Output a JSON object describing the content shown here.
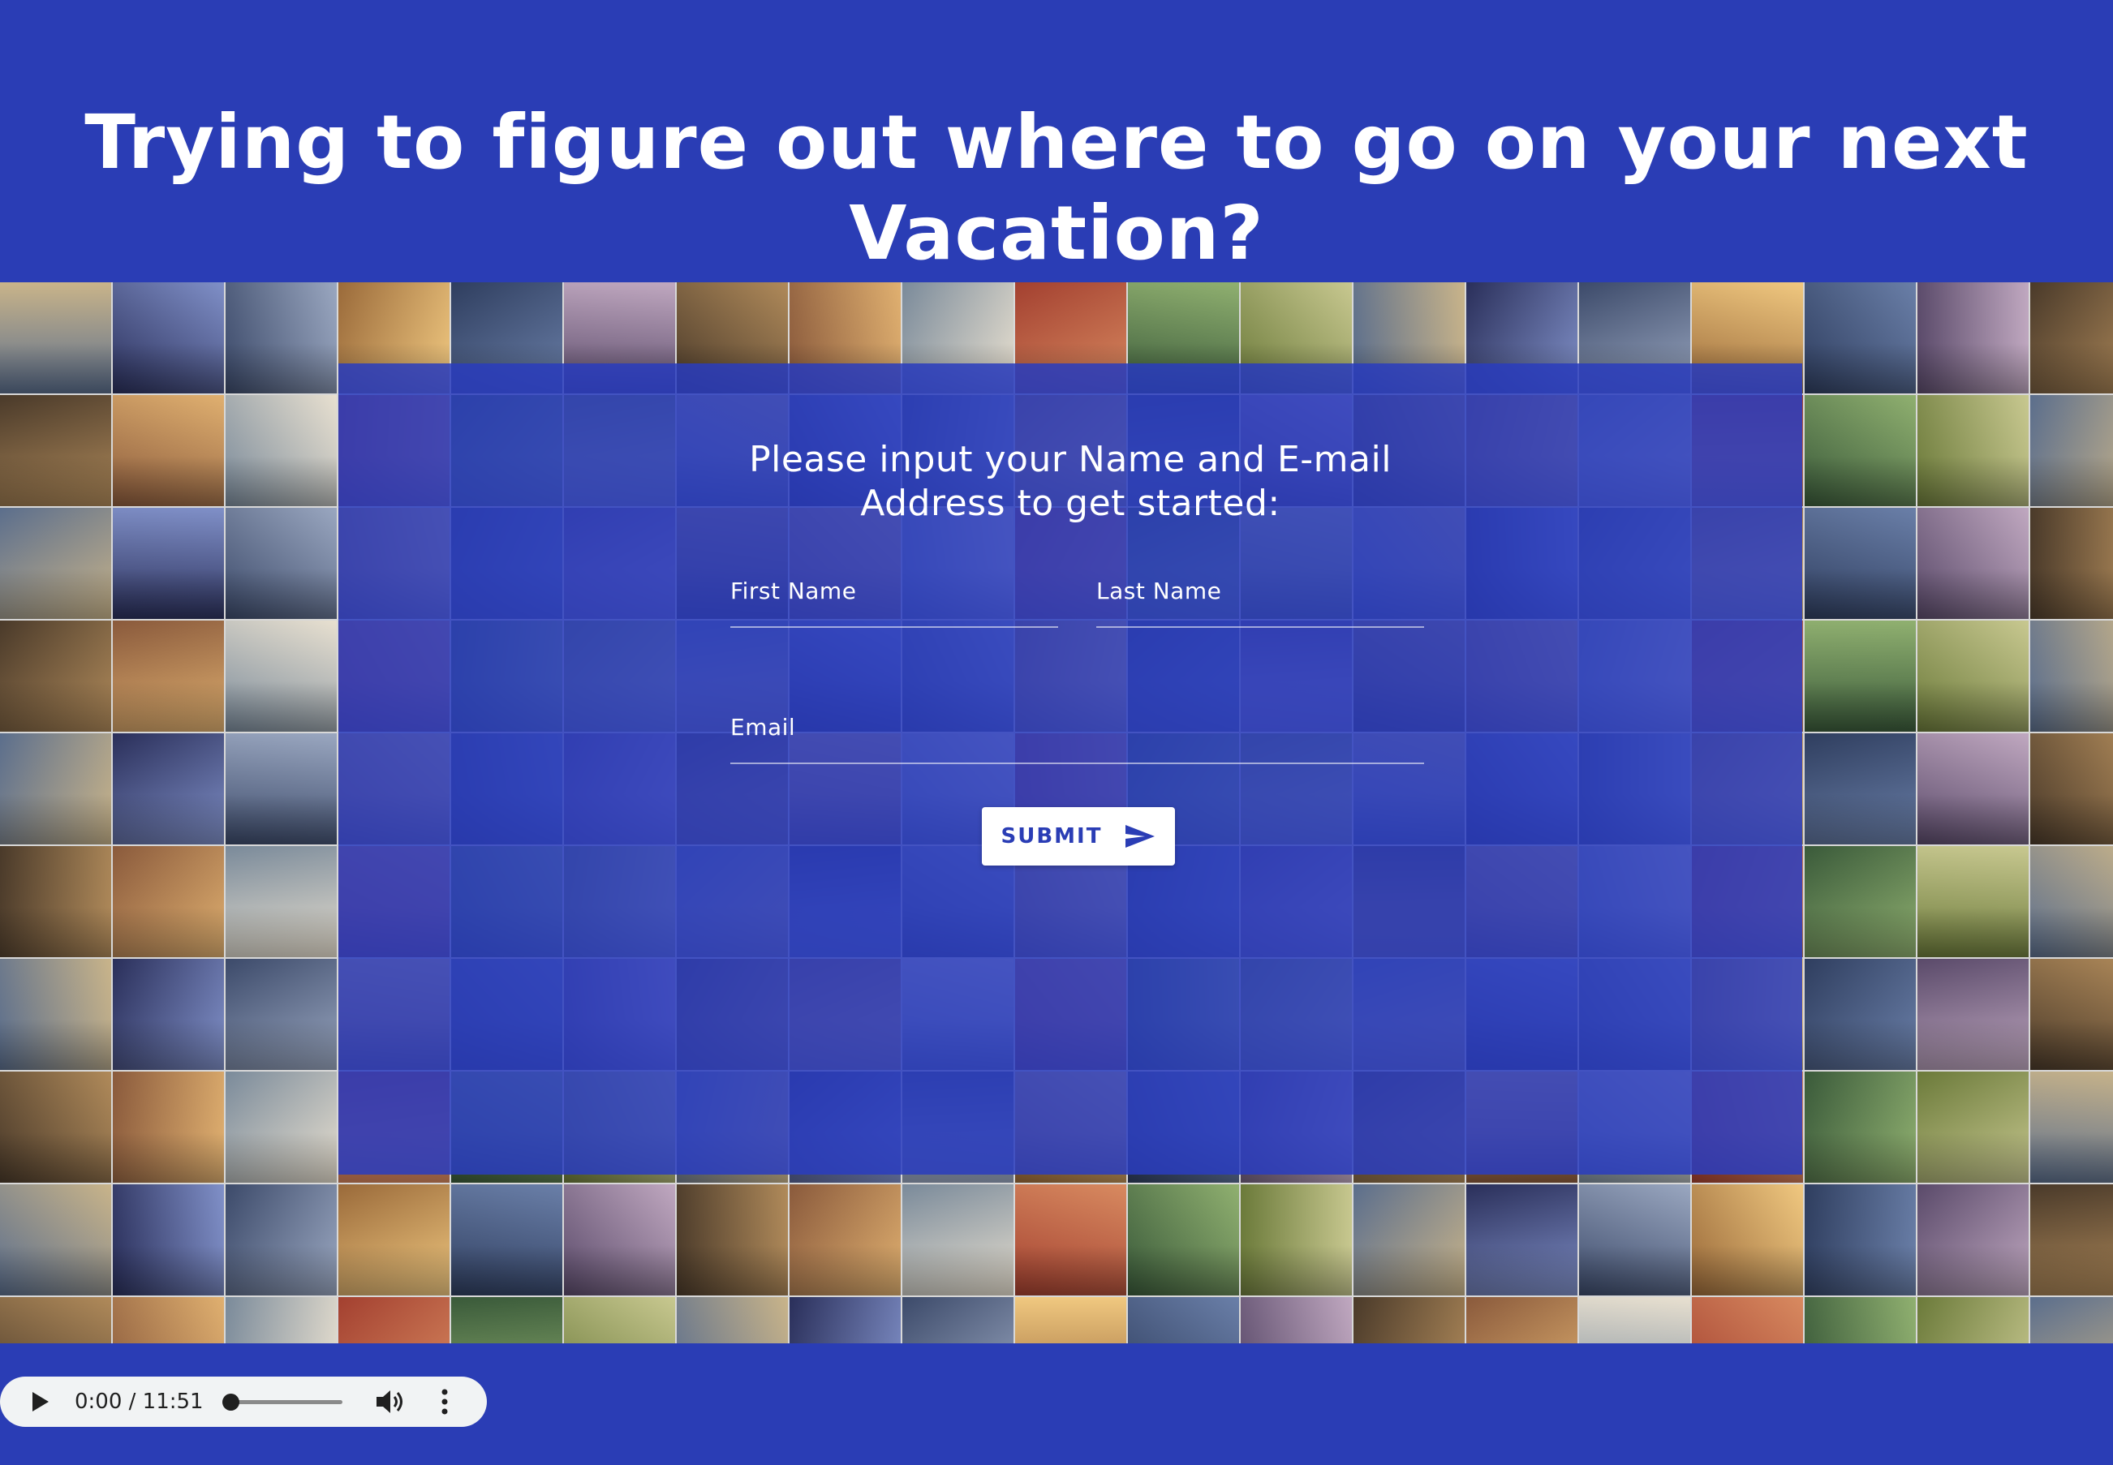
{
  "hero": {
    "title_line1": "Trying to figure out where to go on your next",
    "title_line2": "Vacation?"
  },
  "form": {
    "heading_line1": "Please input your Name and E-mail",
    "heading_line2": "Address to get started:",
    "first_name_label": "First Name",
    "first_name_value": "",
    "last_name_label": "Last Name",
    "last_name_value": "",
    "email_label": "Email",
    "email_value": "",
    "submit_label": "SUBMIT",
    "submit_icon": "send-icon"
  },
  "audio": {
    "time": "0:00 / 11:51",
    "progress": 0,
    "icons": [
      "play-icon",
      "volume-icon",
      "more-vert-icon"
    ]
  },
  "colors": {
    "background": "#2a3db5",
    "panel": "#2a3dbe",
    "text": "#ffffff",
    "button_text": "#2a3db5",
    "player_bg": "#f1f3f4"
  }
}
